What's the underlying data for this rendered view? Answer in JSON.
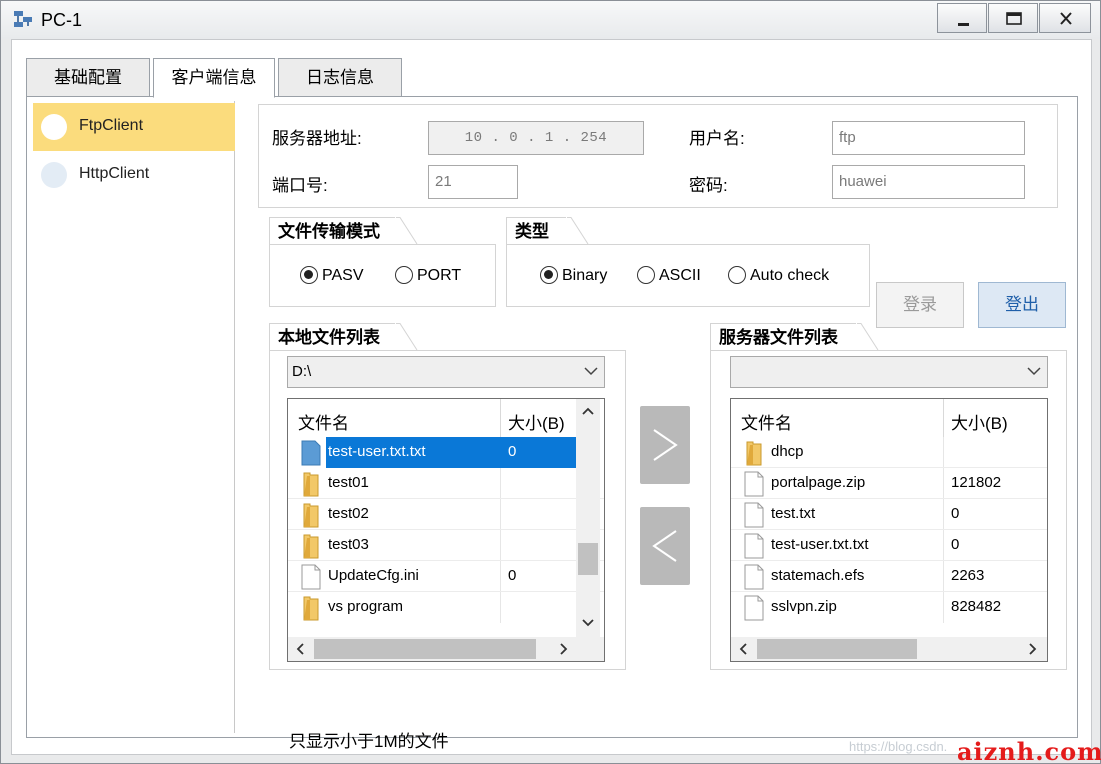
{
  "window": {
    "title": "PC-1",
    "buttons": {
      "minimize_icon": "minimize-icon",
      "maximize_icon": "maximize-icon",
      "close_icon": "close-icon"
    }
  },
  "tabs": [
    {
      "label": "基础配置"
    },
    {
      "label": "客户端信息"
    },
    {
      "label": "日志信息"
    }
  ],
  "sidebar": {
    "items": [
      {
        "label": "FtpClient"
      },
      {
        "label": "HttpClient"
      }
    ]
  },
  "server": {
    "address_label": "服务器地址:",
    "address_value": "10 . 0 . 1 . 254",
    "username_label": "用户名:",
    "username_value": "ftp",
    "port_label": "端口号:",
    "port_value": "21",
    "password_label": "密码:",
    "password_value": "huawei"
  },
  "transfer_mode": {
    "title": "文件传输模式",
    "options": [
      {
        "label": "PASV"
      },
      {
        "label": "PORT"
      }
    ]
  },
  "type": {
    "title": "类型",
    "options": [
      {
        "label": "Binary"
      },
      {
        "label": "ASCII"
      },
      {
        "label": "Auto check"
      }
    ]
  },
  "actions": {
    "login": "登录",
    "logout": "登出"
  },
  "local": {
    "title": "本地文件列表",
    "path": "D:\\",
    "headers": {
      "name": "文件名",
      "size": "大小(B)"
    },
    "files": [
      {
        "name": "test-user.txt.txt",
        "size": "0",
        "icon": "file-icon"
      },
      {
        "name": "test01",
        "size": "",
        "icon": "folder-icon"
      },
      {
        "name": "test02",
        "size": "",
        "icon": "folder-icon"
      },
      {
        "name": "test03",
        "size": "",
        "icon": "folder-icon"
      },
      {
        "name": "UpdateCfg.ini",
        "size": "0",
        "icon": "file-icon"
      },
      {
        "name": "vs program",
        "size": "",
        "icon": "folder-icon"
      }
    ]
  },
  "remote": {
    "title": "服务器文件列表",
    "path": "",
    "headers": {
      "name": "文件名",
      "size": "大小(B)"
    },
    "files": [
      {
        "name": "dhcp",
        "size": "",
        "icon": "folder-icon"
      },
      {
        "name": "portalpage.zip",
        "size": "121802",
        "icon": "file-icon"
      },
      {
        "name": "test.txt",
        "size": "0",
        "icon": "file-icon"
      },
      {
        "name": "test-user.txt.txt",
        "size": "0",
        "icon": "file-icon"
      },
      {
        "name": "statemach.efs",
        "size": "2263",
        "icon": "file-icon"
      },
      {
        "name": "sslvpn.zip",
        "size": "828482",
        "icon": "file-icon"
      }
    ]
  },
  "note": "只显示小于1M的文件",
  "watermark": {
    "text": "https://blog.csdn.",
    "brand": "aiznh.com"
  },
  "colors": {
    "selection": "#0a78d7",
    "active_item": "#fbdc7d",
    "logout_text": "#1f5fa9"
  }
}
